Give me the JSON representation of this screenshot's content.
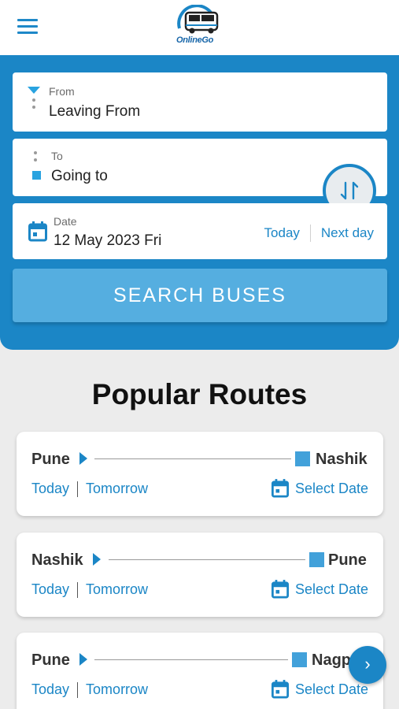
{
  "app": {
    "logo_text": "OnlineGo"
  },
  "search": {
    "from": {
      "label": "From",
      "value": "Leaving From"
    },
    "to": {
      "label": "To",
      "value": "Going to"
    },
    "date": {
      "label": "Date",
      "value": "12 May 2023 Fri",
      "today_label": "Today",
      "next_day_label": "Next day"
    },
    "search_button_label": "SEARCH BUSES"
  },
  "popular": {
    "title": "Popular Routes",
    "routes": [
      {
        "from": "Pune",
        "to": "Nashik",
        "today": "Today",
        "tomorrow": "Tomorrow",
        "select_date": "Select Date"
      },
      {
        "from": "Nashik",
        "to": "Pune",
        "today": "Today",
        "tomorrow": "Tomorrow",
        "select_date": "Select Date"
      },
      {
        "from": "Pune",
        "to": "Nagpur",
        "today": "Today",
        "tomorrow": "Tomorrow",
        "select_date": "Select Date"
      }
    ]
  },
  "colors": {
    "primary": "#1b86c6",
    "button": "#55aee0",
    "accent": "#29a3e0",
    "background": "#ececec"
  },
  "icons": {
    "menu": "hamburger-menu-icon",
    "swap": "swap-vertical-arrows-icon",
    "calendar": "calendar-icon",
    "scroll": "chevron-right-icon"
  }
}
